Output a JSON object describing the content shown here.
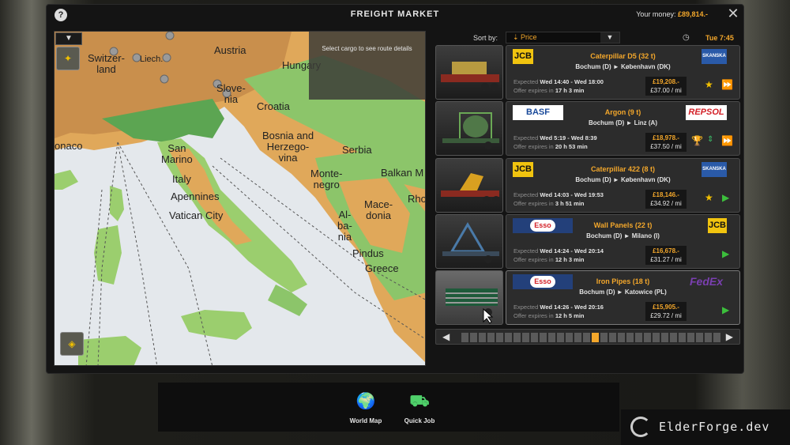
{
  "header": {
    "title": "FREIGHT MARKET",
    "money_label": "Your money:",
    "money_value": "£89,814.-"
  },
  "map": {
    "hint": "Select cargo to see route details",
    "labels": [
      "Switzer-\nland",
      "Liech.",
      "Austria",
      "Hungary",
      "Slove-\nnia",
      "Croatia",
      "Bosnia and\nHerzego-\nvina",
      "Serbia",
      "San\nMarino",
      "Italy",
      "Apennines",
      "Vatican City",
      "Monte-\nnegro",
      "Balkan M",
      "Rho",
      "Mace-\ndonia",
      "Al-\nba-\nnia",
      "Pindus",
      "Greece",
      "onaco"
    ]
  },
  "sort": {
    "label": "Sort by:",
    "value": "Price",
    "time": "Tue 7:45"
  },
  "jobs": [
    {
      "logo_left": "JCB",
      "logo_right": "SKANSKA",
      "cargo": "Caterpillar D5 (32 t)",
      "route": "Bochum (D) ► København (DK)",
      "expected": "Wed 14:40 - Wed 18:00",
      "expires": "17 h 3 min",
      "price": "£19,208.-",
      "per_mile": "£37.00 / mi",
      "actions": [
        "star-icon",
        "fast-forward-icon"
      ]
    },
    {
      "logo_left": "BASF",
      "logo_right": "REPSOL",
      "cargo": "Argon (9 t)",
      "route": "Bochum (D) ► Linz (A)",
      "expected": "Wed 5:19 - Wed 8:39",
      "expires": "20 h 53 min",
      "price": "£18,978.-",
      "per_mile": "£37.50 / mi",
      "actions": [
        "trophy-icon",
        "updown-icon",
        "fast-forward-icon"
      ]
    },
    {
      "logo_left": "JCB",
      "logo_right": "SKANSKA",
      "cargo": "Caterpillar 422 (8 t)",
      "route": "Bochum (D) ► København (DK)",
      "expected": "Wed 14:03 - Wed 19:53",
      "expires": "3 h 51 min",
      "price": "£18,146.-",
      "per_mile": "£34.92 / mi",
      "actions": [
        "star-icon",
        "play-icon"
      ]
    },
    {
      "logo_left": "Esso",
      "logo_right": "JCB",
      "cargo": "Wall Panels (22 t)",
      "route": "Bochum (D) ► Milano (I)",
      "expected": "Wed 14:24 - Wed 20:14",
      "expires": "12 h 3 min",
      "price": "£16,678.-",
      "per_mile": "£31.27 / mi",
      "actions": [
        "play-icon"
      ]
    },
    {
      "logo_left": "Esso",
      "logo_right": "FedEx",
      "cargo": "Iron Pipes (18 t)",
      "route": "Bochum (D) ► Katowice (PL)",
      "expected": "Wed 14:26 - Wed 20:16",
      "expires": "12 h 5 min",
      "price": "£15,905.-",
      "per_mile": "£29.72 / mi",
      "actions": [
        "play-icon"
      ]
    }
  ],
  "labels": {
    "expected": "Expected",
    "expires": "Offer expires in"
  },
  "bottom": {
    "world_map": "World Map",
    "quick_job": "Quick Job"
  },
  "watermark": "ElderForge.dev",
  "colors": {
    "accent": "#f3a72b",
    "panel": "#141414",
    "card": "#2c2c2c"
  }
}
